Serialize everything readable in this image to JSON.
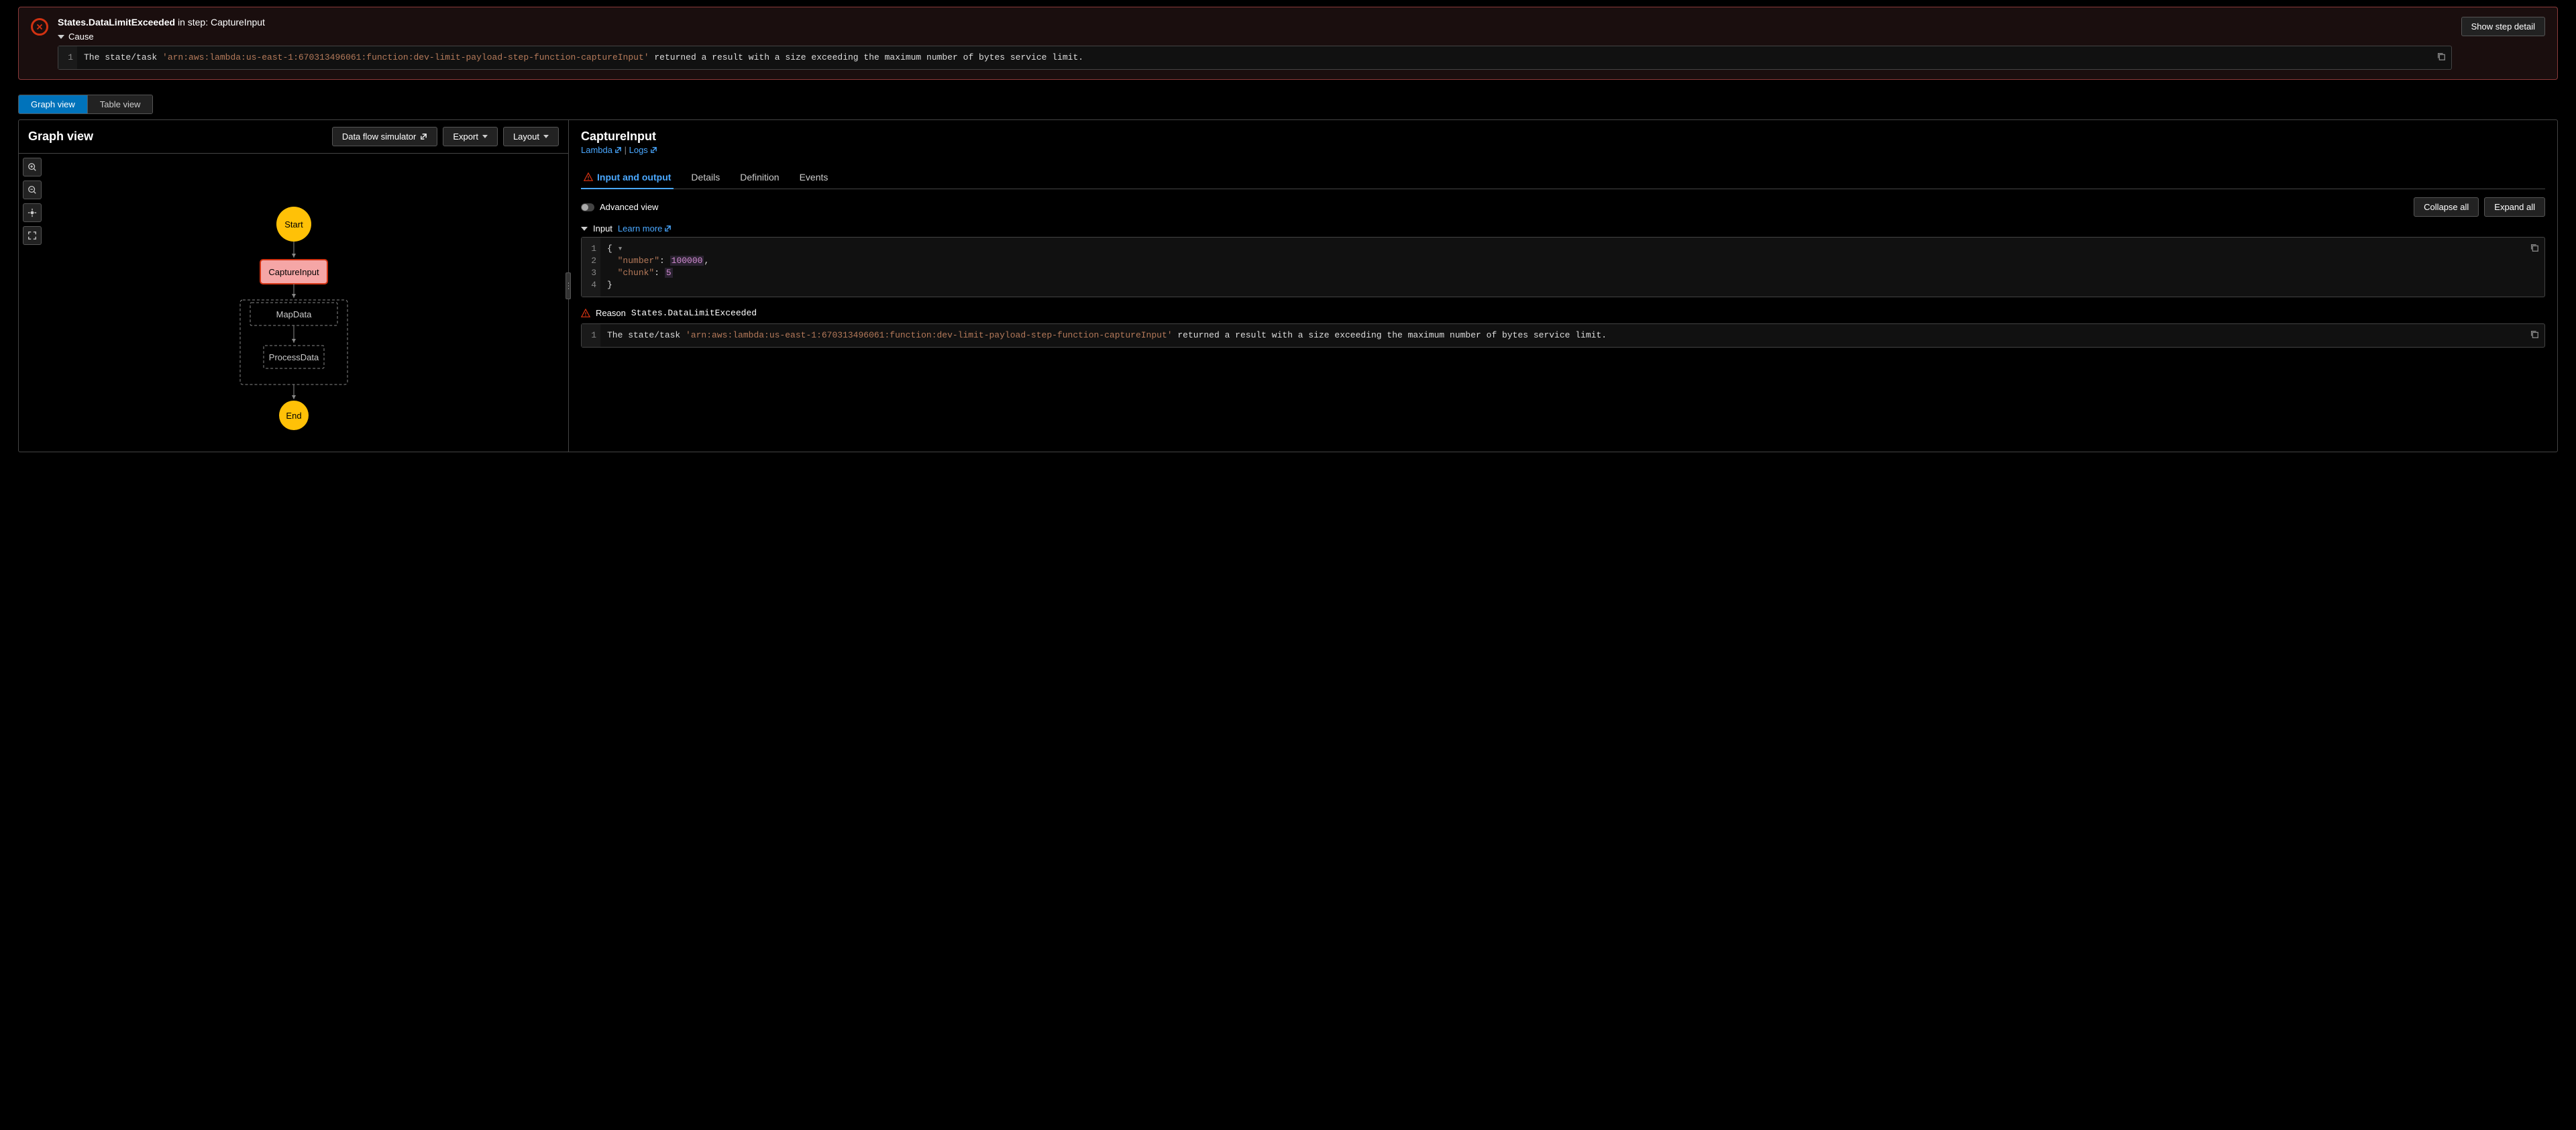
{
  "banner": {
    "error_name": "States.DataLimitExceeded",
    "in_step": " in step: ",
    "step_name": "CaptureInput",
    "cause_label": "Cause",
    "show_detail": "Show step detail",
    "code_line": "1",
    "code_prefix": "The state/task ",
    "code_arn": "'arn:aws:lambda:us-east-1:670313496061:function:dev-limit-payload-step-function-captureInput'",
    "code_suffix": " returned a result with a size exceeding the maximum number of bytes service limit."
  },
  "viewTabs": {
    "graph": "Graph view",
    "table": "Table view"
  },
  "leftPane": {
    "title": "Graph view",
    "dfs": "Data flow simulator",
    "export": "Export",
    "layout": "Layout"
  },
  "graph": {
    "start": "Start",
    "capture": "CaptureInput",
    "map": "MapData",
    "process": "ProcessData",
    "end": "End"
  },
  "rightPane": {
    "title": "CaptureInput",
    "lambda": "Lambda",
    "sep": " | ",
    "logs": "Logs"
  },
  "tabs": {
    "io": "Input and output",
    "details": "Details",
    "definition": "Definition",
    "events": "Events"
  },
  "adv": {
    "label": "Advanced view",
    "collapse": "Collapse all",
    "expand": "Expand all"
  },
  "inputSection": {
    "label": "Input",
    "learn": "Learn more",
    "lines": [
      "1",
      "2",
      "3",
      "4"
    ],
    "l1": "{",
    "l2k": "\"number\"",
    "l2c": ": ",
    "l2v": "100000",
    "l2e": ",",
    "l3k": "\"chunk\"",
    "l3c": ": ",
    "l3v": "5",
    "l4": "}"
  },
  "reason": {
    "label": "Reason",
    "value": "States.DataLimitExceeded",
    "line": "1",
    "prefix": "The state/task ",
    "arn": "'arn:aws:lambda:us-east-1:670313496061:function:dev-limit-payload-step-function-captureInput'",
    "suffix": " returned a result with a size exceeding the maximum number of bytes service limit."
  }
}
